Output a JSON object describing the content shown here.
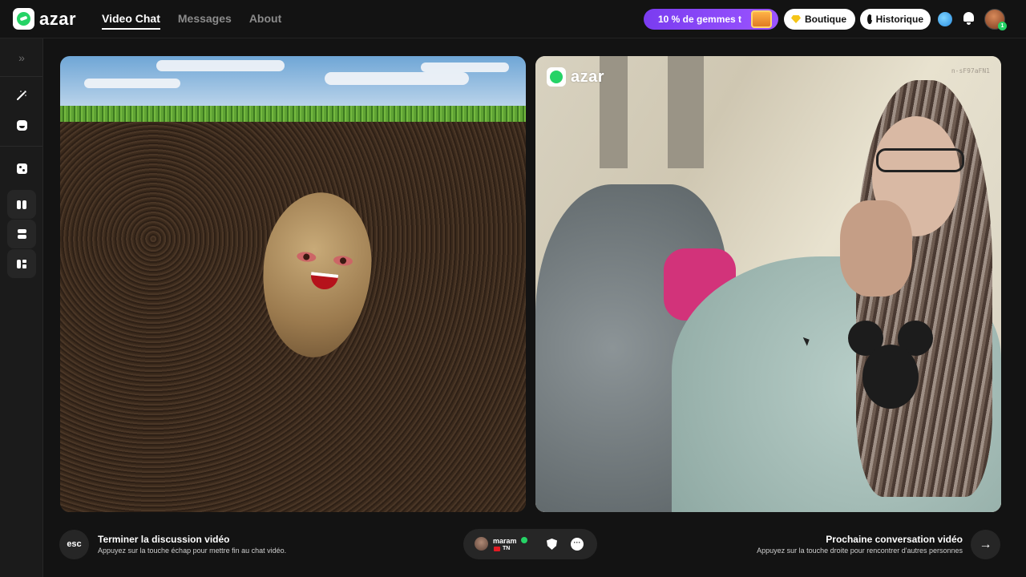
{
  "app": {
    "name": "azar"
  },
  "nav": {
    "items": [
      {
        "label": "Video Chat",
        "active": true
      },
      {
        "label": "Messages",
        "active": false
      },
      {
        "label": "About",
        "active": false
      }
    ]
  },
  "header": {
    "promo_text": "10 % de gemmes t",
    "boutique_label": "Boutique",
    "history_label": "Historique",
    "notification_icon": "bell-icon",
    "globe_icon": "globe-icon",
    "avatar_badge": "1"
  },
  "sidebar": {
    "items": [
      {
        "icon": "expand-icon"
      },
      {
        "icon": "magic-wand-icon"
      },
      {
        "icon": "face-filter-icon"
      },
      {
        "icon": "dice-icon"
      },
      {
        "icon": "layout-side-by-side-icon"
      },
      {
        "icon": "layout-stacked-icon"
      },
      {
        "icon": "layout-grid-icon"
      }
    ]
  },
  "video": {
    "watermark": "azar",
    "stream_id": "n-sF97aFN1"
  },
  "bottom": {
    "esc_label": "esc",
    "end_title": "Terminer la discussion vidéo",
    "end_subtitle": "Appuyez sur la touche échap pour mettre fin au chat vidéo.",
    "peer": {
      "name": "maram",
      "country": "TN"
    },
    "next_title": "Prochaine conversation vidéo",
    "next_subtitle": "Appuyez sur la touche droite pour rencontrer d'autres personnes",
    "next_arrow": "→"
  },
  "colors": {
    "brand": "#25d366",
    "promo": "#8a47f7",
    "background": "#131313",
    "sidebar": "#1b1b1b"
  }
}
